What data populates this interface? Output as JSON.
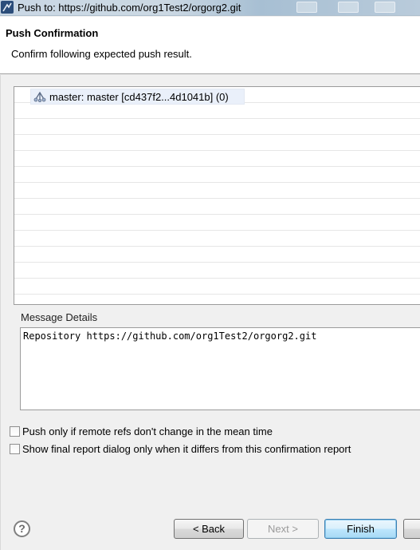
{
  "window": {
    "title": "Push to: https://github.com/org1Test2/orgorg2.git"
  },
  "header": {
    "title": "Push Confirmation",
    "description": "Confirm following expected push result."
  },
  "results": {
    "rows": [
      {
        "icon": "branch-icon",
        "label": "master: master [cd437f2...4d1041b] (0)"
      }
    ]
  },
  "message": {
    "label": "Message Details",
    "text": "Repository https://github.com/org1Test2/orgorg2.git"
  },
  "options": {
    "push_only_if_unchanged": {
      "label": "Push only if remote refs don't change in the mean time",
      "checked": false
    },
    "show_final_report": {
      "label": "Show final report dialog only when it differs from this confirmation report",
      "checked": false
    }
  },
  "buttons": {
    "help": "?",
    "back": "< Back",
    "next": "Next >",
    "finish": "Finish"
  },
  "colors": {
    "default_button_border": "#3c7fb1",
    "selection_bg": "#eaf0fa"
  }
}
